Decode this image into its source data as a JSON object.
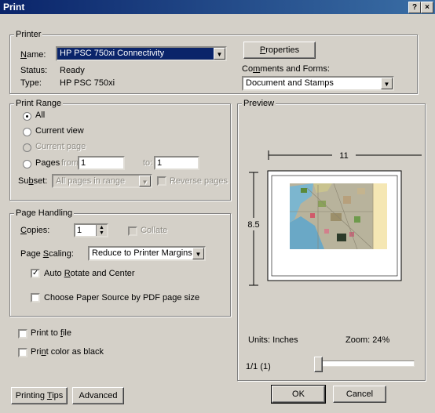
{
  "window": {
    "title": "Print",
    "help_icon": "?",
    "close_icon": "×"
  },
  "printer": {
    "group_label": "Printer",
    "name_label": "Name:",
    "name_value": "HP PSC 750xi Connectivity",
    "status_label": "Status:",
    "status_value": "Ready",
    "type_label": "Type:",
    "type_value": "HP PSC 750xi",
    "properties_button": "Properties",
    "comments_label": "Comments and Forms:",
    "comments_value": "Document and Stamps"
  },
  "print_range": {
    "group_label": "Print Range",
    "all": "All",
    "current_view": "Current view",
    "current_page": "Current page",
    "pages": "Pages",
    "from_label": "from:",
    "from_value": "1",
    "to_label": "to:",
    "to_value": "1",
    "subset_label": "Subset:",
    "subset_value": "All pages in range",
    "reverse_pages": "Reverse pages",
    "selected": "All"
  },
  "page_handling": {
    "group_label": "Page Handling",
    "copies_label": "Copies:",
    "copies_value": "1",
    "collate": "Collate",
    "scaling_label": "Page Scaling:",
    "scaling_value": "Reduce to Printer Margins",
    "auto_rotate": "Auto Rotate and Center",
    "auto_rotate_checked": true,
    "choose_paper": "Choose Paper Source by PDF page size",
    "choose_paper_checked": false
  },
  "options": {
    "print_to_file": "Print to file",
    "print_color_black": "Print color as black"
  },
  "preview": {
    "group_label": "Preview",
    "width_label": "11",
    "height_label": "8.5",
    "units_label": "Units: Inches",
    "zoom_label": "Zoom: 24%",
    "page_indicator": "1/1 (1)",
    "slider_position": 0
  },
  "buttons": {
    "printing_tips": "Printing Tips",
    "advanced": "Advanced",
    "ok": "OK",
    "cancel": "Cancel"
  },
  "colors": {
    "title_start": "#0a246a",
    "title_end": "#3a6ea5",
    "selection": "#0a246a",
    "face": "#d4d0c8"
  }
}
